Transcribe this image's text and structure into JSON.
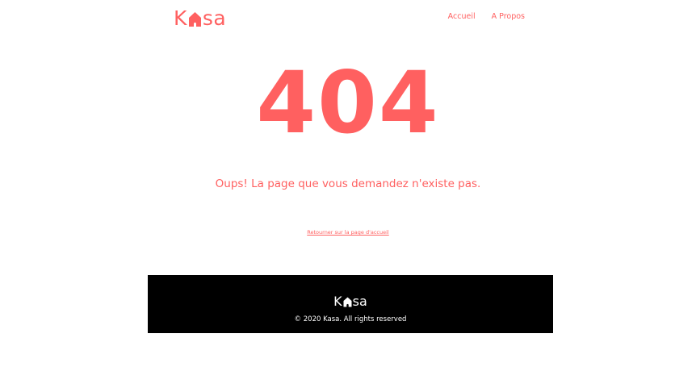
{
  "colors": {
    "accent": "#ff6060",
    "footer_bg": "#000000",
    "footer_text": "#ffffff",
    "background": "#ffffff"
  },
  "header": {
    "logo": {
      "prefix": "K",
      "icon": "house-icon",
      "suffix": "sa"
    },
    "nav": [
      {
        "label": "Accueil"
      },
      {
        "label": "A Propos"
      }
    ]
  },
  "main": {
    "error_code": "404",
    "message": "Oups! La page que vous demandez n'existe pas.",
    "back_link": "Retourner sur la page d'accueil"
  },
  "footer": {
    "logo": {
      "prefix": "K",
      "icon": "house-icon",
      "suffix": "sa"
    },
    "copyright": "© 2020 Kasa. All rights reserved"
  }
}
